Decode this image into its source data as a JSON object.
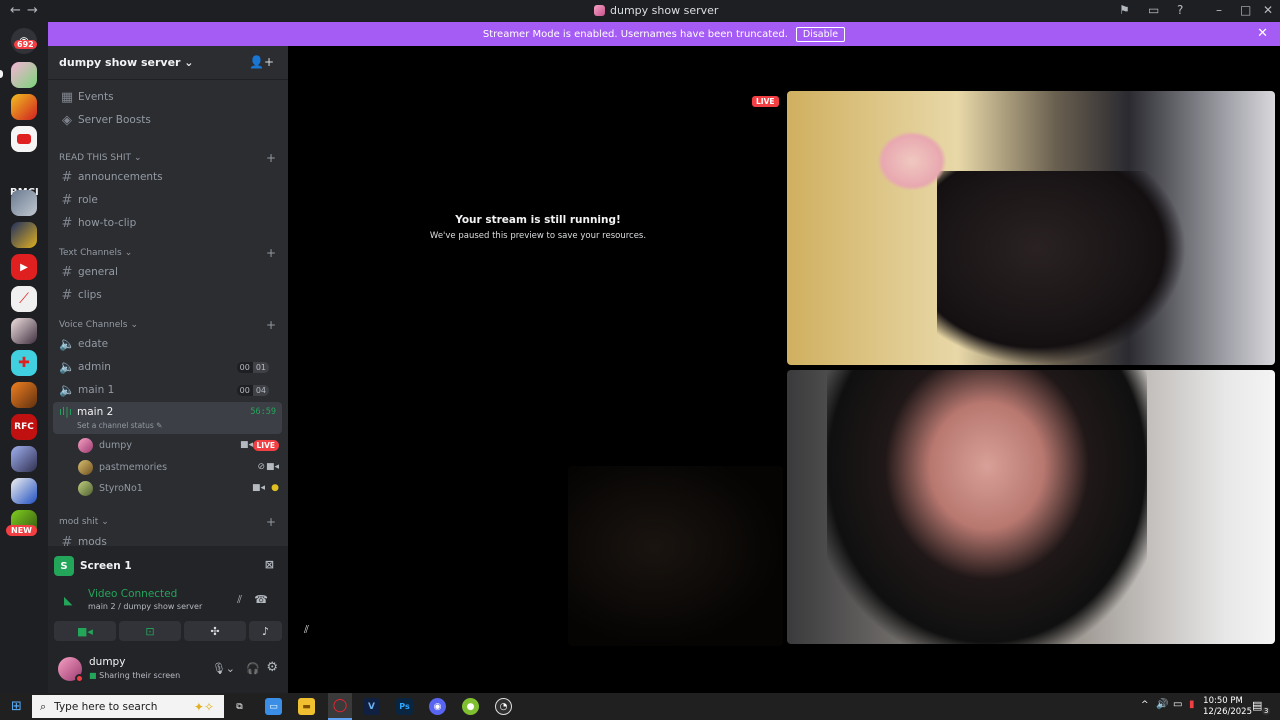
{
  "window": {
    "title": "dumpy show server",
    "back": "←",
    "forward": "→"
  },
  "rail": {
    "mentions_badge": "692",
    "text_server": "RMCI",
    "new_badge": "NEW"
  },
  "banner": {
    "message": "Streamer Mode is enabled. Usernames have been truncated.",
    "disable_label": "Disable",
    "close": "✕"
  },
  "server": {
    "name": "dumpy show server",
    "top_items": [
      {
        "label": "Events",
        "icon": "calendar-icon"
      },
      {
        "label": "Server Boosts",
        "icon": "boost-icon"
      }
    ],
    "categories": {
      "read": "READ THIS SHIT",
      "text": "Text Channels",
      "voice": "Voice Channels",
      "mod": "mod shit"
    },
    "read_channels": [
      "announcements",
      "role",
      "how-to-clip"
    ],
    "text_channels": [
      "general",
      "clips"
    ],
    "voice_channels": [
      {
        "name": "edate"
      },
      {
        "name": "admin",
        "count_a": "00",
        "count_b": "01"
      },
      {
        "name": "main 1",
        "count_a": "00",
        "count_b": "04"
      }
    ],
    "active_channel": {
      "name": "main 2",
      "timer": "56:59",
      "status_hint": "Set a channel status"
    },
    "members": [
      {
        "name": "dumpy",
        "live": "LIVE"
      },
      {
        "name": "pastmemories"
      },
      {
        "name": "StyroNo1"
      }
    ],
    "mod_channels": [
      "mods"
    ]
  },
  "panel": {
    "screen_title": "Screen 1",
    "voice_status": "Video Connected",
    "voice_location": "main 2 / dumpy show server",
    "username": "dumpy",
    "user_status": "Sharing their screen"
  },
  "stage": {
    "paused_title": "Your stream is still running!",
    "paused_sub": "We've paused this preview to save your resources.",
    "live": "LIVE"
  },
  "taskbar": {
    "search_placeholder": "Type here to search",
    "time": "10:50 PM",
    "date": "12/26/2025",
    "notif": "3"
  },
  "colors": {
    "banner": "#a55cf5",
    "live": "#f23f43",
    "connected": "#23a55a",
    "sidebar": "#2b2d31",
    "rail": "#1e1f22"
  }
}
